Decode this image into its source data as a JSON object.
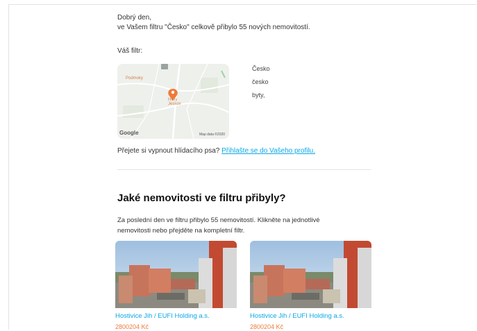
{
  "email": {
    "greeting": "Dobrý den,",
    "summary": "ve Vašem filtru \"Česko\" celkově přibylo 55 nových nemovitostí.",
    "filter_label": "Váš filtr:",
    "map": {
      "place_top": "Podmoky",
      "place_center": "Hliny Jeskov",
      "road_badge": "33",
      "google_label": "Google",
      "copyright": "Map data ©2020"
    },
    "criteria": [
      "Česko",
      "česko",
      "byty,"
    ],
    "watchdog_text": "Přejete si vypnout hlídacího psa?",
    "watchdog_link": "Přihlašte se do Vašeho profilu.",
    "section_heading": "Jaké nemovitosti ve filtru přibyly?",
    "section_intro": "Za poslední den ve filtru přibylo 55 nemovitostí. Klikněte na jednotlivé nemovitosti nebo přejděte na kompletní filtr.",
    "listings": [
      {
        "title": "Hostivice Jih / EUFI Holding a.s.",
        "price": "2800204 Kč"
      },
      {
        "title": "Hostivice Jih / EUFI Holding a.s.",
        "price": "2800204 Kč"
      }
    ]
  },
  "colors": {
    "link": "#0aa8e6",
    "price": "#f07a3a",
    "map_pin": "#f07a3a"
  }
}
